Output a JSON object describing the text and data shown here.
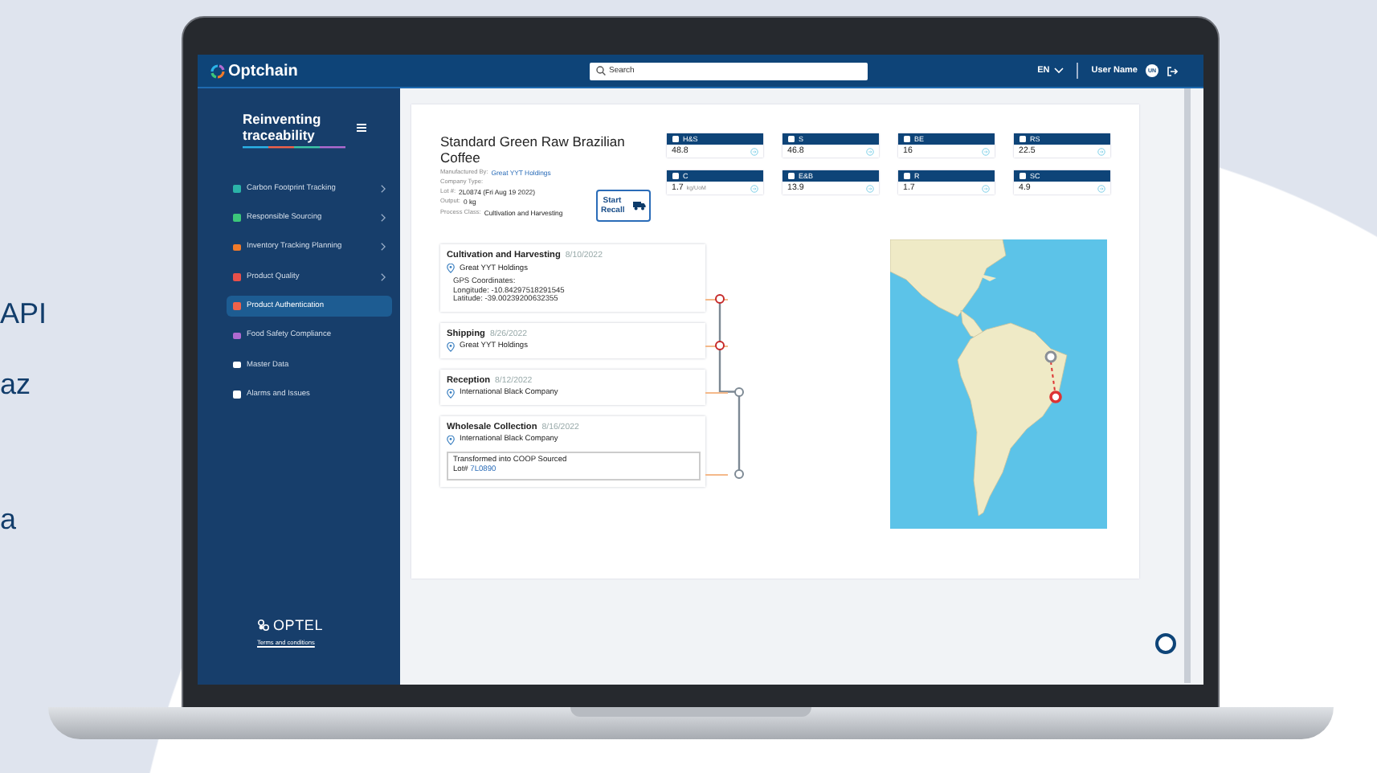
{
  "side_text": [
    "API",
    "az",
    "a"
  ],
  "topbar": {
    "logo": "Optchain",
    "search": {
      "placeholder": "Search"
    },
    "language": "EN",
    "user_name": "User Name",
    "user_initials": "UN"
  },
  "sidebar": {
    "title": [
      "Reinventing",
      "traceability"
    ],
    "items": [
      {
        "label": "Carbon Footprint Tracking",
        "selected": false,
        "submenu": true,
        "color": "#2bb3a8"
      },
      {
        "label": "Responsible Sourcing",
        "selected": false,
        "submenu": true,
        "color": "#3cc77a"
      },
      {
        "label": "Inventory Tracking Planning",
        "selected": false,
        "submenu": true,
        "color": "#f07a2a"
      },
      {
        "label": "Product Quality",
        "selected": false,
        "submenu": true,
        "color": "#e8504a"
      },
      {
        "label": "Product Authentication",
        "selected": true,
        "submenu": false,
        "color": "#f0624a"
      },
      {
        "label": "Food Safety Compliance",
        "selected": false,
        "submenu": false,
        "color": "#b06ad0"
      },
      {
        "label": "Master Data",
        "selected": false,
        "submenu": false,
        "color": "#ffffff"
      },
      {
        "label": "Alarms and Issues",
        "selected": false,
        "submenu": false,
        "color": "#ffffff"
      }
    ],
    "footer_logo": "OPTEL",
    "terms": "Terms and conditions"
  },
  "product": {
    "title": "Standard Green Raw Brazilian Coffee",
    "fields": [
      {
        "label": "Manufactured By:",
        "value": "Great YYT Holdings",
        "link": true
      },
      {
        "label": "Company Type:"
      },
      {
        "label": "Lot #:",
        "value": "2L0874 (Fri Aug 19 2022)",
        "link": false
      },
      {
        "label": "Output:",
        "value": "0 kg",
        "link": false
      },
      {
        "label": "Process Class:",
        "value": "Cultivation and Harvesting",
        "link": false
      }
    ],
    "recall_button": "Start Recall"
  },
  "metrics": [
    {
      "label": "H&S",
      "value": "48.8"
    },
    {
      "label": "S",
      "value": "46.8"
    },
    {
      "label": "BE",
      "value": "16"
    },
    {
      "label": "RS",
      "value": "22.5"
    },
    {
      "label": "C",
      "value": "1.7",
      "unit": "kg/UoM"
    },
    {
      "label": "E&B",
      "value": "13.9"
    },
    {
      "label": "R",
      "value": "1.7"
    },
    {
      "label": "SC",
      "value": "4.9"
    }
  ],
  "timeline": [
    {
      "title": "Cultivation and Harvesting",
      "date": "8/10/2022",
      "location": "Great YYT Holdings",
      "highlighted": true,
      "details": [
        "GPS Coordinates:",
        "Longitude: -10.84297518291545",
        "Latitude: -39.00239200632355"
      ]
    },
    {
      "title": "Shipping",
      "date": "8/26/2022",
      "location": "Great YYT Holdings",
      "highlighted": true
    },
    {
      "title": "Reception",
      "date": "8/12/2022",
      "location": "International Black Company",
      "highlighted": false
    },
    {
      "title": "Wholesale Collection",
      "date": "8/16/2022",
      "location": "International Black Company",
      "highlighted": false,
      "note": "Transformed into COOP Sourced",
      "lot_label": "Lot#",
      "lot_link": "7L0890"
    }
  ]
}
